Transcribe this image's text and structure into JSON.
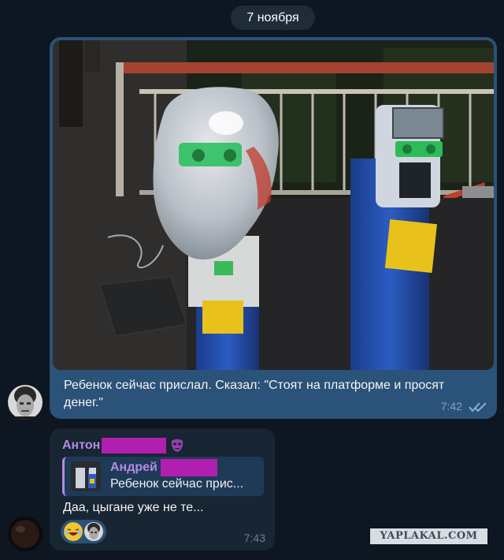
{
  "chat": {
    "date_separator": "7 ноября",
    "outgoing": {
      "text": "Ребенок сейчас прислал. Сказал: \"Стоят на платформе и просят денег.\"",
      "time": "7:42",
      "status_icon": "double-check-icon"
    },
    "incoming": {
      "sender": "Антон",
      "reply": {
        "author": "Андрей",
        "preview": "Ребенок сейчас прис..."
      },
      "text": "Даа, цыгане уже не те...",
      "time": "7:43",
      "reactions": [
        "laughing-emoji",
        "old-man-avatar"
      ]
    }
  },
  "watermark": "YAPLAKAL.COM",
  "colors": {
    "background": "#0e1621",
    "outgoing_bubble": "#2b5278",
    "incoming_bubble": "#182533",
    "sender_name": "#b58ae0",
    "redaction": "#b01fb0"
  }
}
